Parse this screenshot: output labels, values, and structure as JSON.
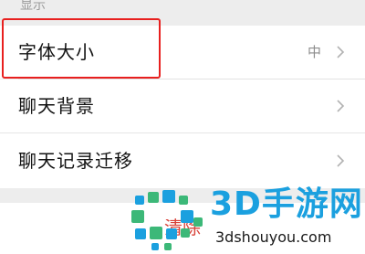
{
  "settings": {
    "section_header": "显示",
    "rows": [
      {
        "label": "字体大小",
        "value": "中"
      },
      {
        "label": "聊天背景",
        "value": ""
      },
      {
        "label": "聊天记录迁移",
        "value": ""
      }
    ],
    "clear_label": "清除"
  },
  "watermark": {
    "brand": "3D手游网",
    "url": "3dshouyou.com"
  },
  "colors": {
    "background": "#ededed",
    "highlight_border": "#e8201f",
    "danger_text": "#d9433a",
    "watermark_blue": "#1ba0df",
    "watermark_green": "#3cb878"
  },
  "icons": {
    "chevron": "chevron-right-icon",
    "logo": "3dshouyou-logo-icon"
  }
}
